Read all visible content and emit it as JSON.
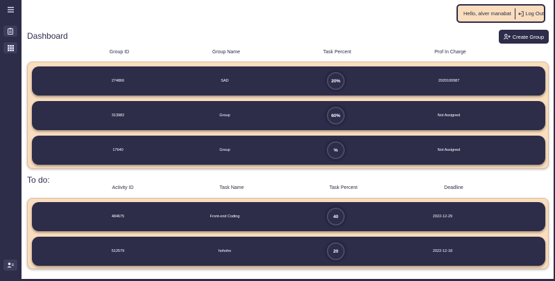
{
  "user": {
    "greeting": "Hello, alver manabat",
    "logout_label": "Log Out"
  },
  "dashboard": {
    "title": "Dashboard",
    "create_label": "Create Group",
    "columns": [
      "Group ID",
      "Group Name",
      "Task Percent",
      "Prof In Charge"
    ],
    "rows": [
      {
        "id": "274866",
        "name": "SAD",
        "percent": "20%",
        "prof": "2020100987"
      },
      {
        "id": "313982",
        "name": "Group",
        "percent": "60%",
        "prof": "Not Assigned"
      },
      {
        "id": "17640",
        "name": "Group",
        "percent": "%",
        "prof": "Not Assigned"
      }
    ]
  },
  "todo": {
    "title": "To do:",
    "columns": [
      "Activity ID",
      "Task Name",
      "Task Percent",
      "Deadline"
    ],
    "rows": [
      {
        "id": "484675",
        "name": "Front-end Coding",
        "percent": "40",
        "deadline": "2022-12-29"
      },
      {
        "id": "512579",
        "name": "hohoho",
        "percent": "20",
        "deadline": "2022-12-18"
      }
    ]
  },
  "sidebar": {
    "items": [
      {
        "icon": "menu-icon"
      },
      {
        "icon": "clipboard-icon"
      },
      {
        "icon": "grid-icon"
      },
      {
        "icon": "users-icon"
      }
    ]
  },
  "colors": {
    "navy": "#2d2c49",
    "peach": "#f9ddbd",
    "white": "#ffffff"
  }
}
